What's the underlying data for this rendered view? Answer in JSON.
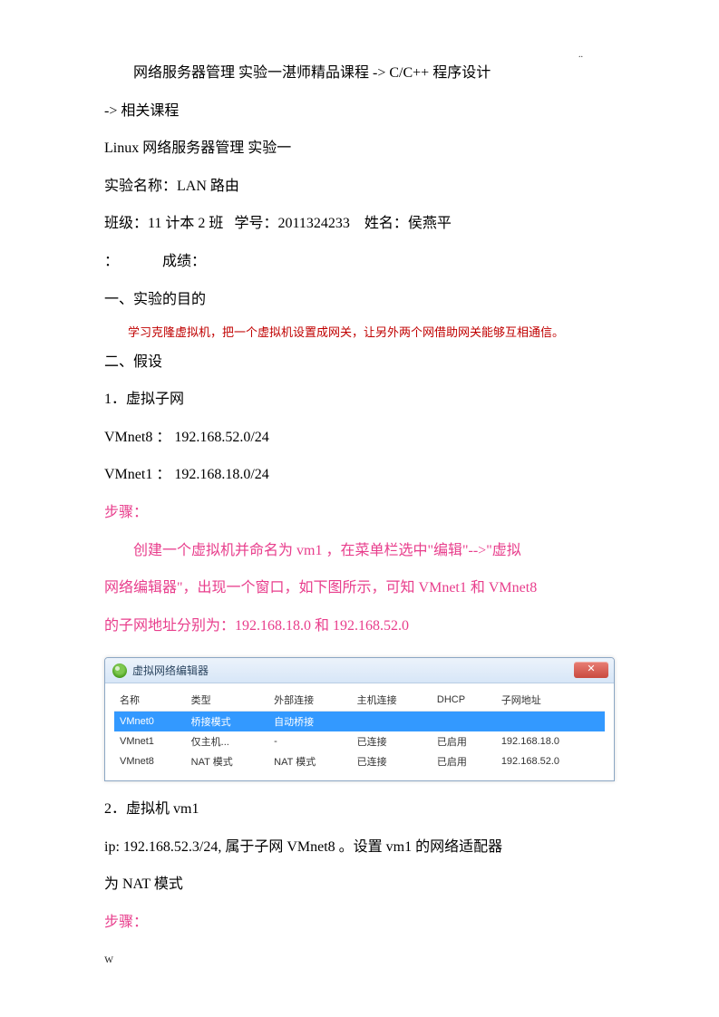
{
  "header_dots": "..",
  "breadcrumb": "网络服务器管理 实验一湛师精品课程 -> C/C++   程序设计",
  "breadcrumb2": "-> 相关课程",
  "title": "Linux 网络服务器管理  实验一",
  "exp_name_label": "实验名称：",
  "exp_name_value": "LAN 路由",
  "class_label": "班级：",
  "class_value": "11 计本 2 班",
  "sid_label": "学号：",
  "sid_value": "2011324233",
  "name_label": "姓名：",
  "name_value": "侯燕平",
  "colon": "：",
  "score_label": "成绩：",
  "sec1": "一、实验的目的",
  "purpose_red": "学习克隆虚拟机，把一个虚拟机设置成网关，让另外两个网借助网关能够互相通信。",
  "sec2": "二、假设",
  "item1": "1．虚拟子网",
  "vmnet8": "VMnet8 ： 192.168.52.0/24",
  "vmnet1": "VMnet1 ： 192.168.18.0/24",
  "steps_label": "步骤：",
  "step_desc1": "创建一个虚拟机并命名为 vm1 ，在菜单栏选中\"编辑\"-->\"虚拟",
  "step_desc2": "网络编辑器\"，出现一个窗口，如下图所示，可知 VMnet1  和 VMnet8",
  "step_desc3": "的子网地址分别为：192.168.18.0 和 192.168.52.0",
  "win": {
    "title": "虚拟网络编辑器",
    "close": "✕",
    "cols": {
      "name": "名称",
      "type": "类型",
      "ext": "外部连接",
      "host": "主机连接",
      "dhcp": "DHCP",
      "subnet": "子网地址"
    },
    "rows": [
      {
        "name": "VMnet0",
        "type": "桥接模式",
        "ext": "自动桥接",
        "host": "",
        "dhcp": "",
        "subnet": ""
      },
      {
        "name": "VMnet1",
        "type": "仅主机...",
        "ext": "-",
        "host": "已连接",
        "dhcp": "已启用",
        "subnet": "192.168.18.0"
      },
      {
        "name": "VMnet8",
        "type": "NAT 模式",
        "ext": "NAT 模式",
        "host": "已连接",
        "dhcp": "已启用",
        "subnet": "192.168.52.0"
      }
    ]
  },
  "item2": "2．虚拟机  vm1",
  "vm1_line1": "ip:  192.168.52.3/24, 属于子网 VMnet8 。设置 vm1  的网络适配器",
  "vm1_line2": "为 NAT 模式",
  "steps_label2": "步骤：",
  "footer": "w"
}
